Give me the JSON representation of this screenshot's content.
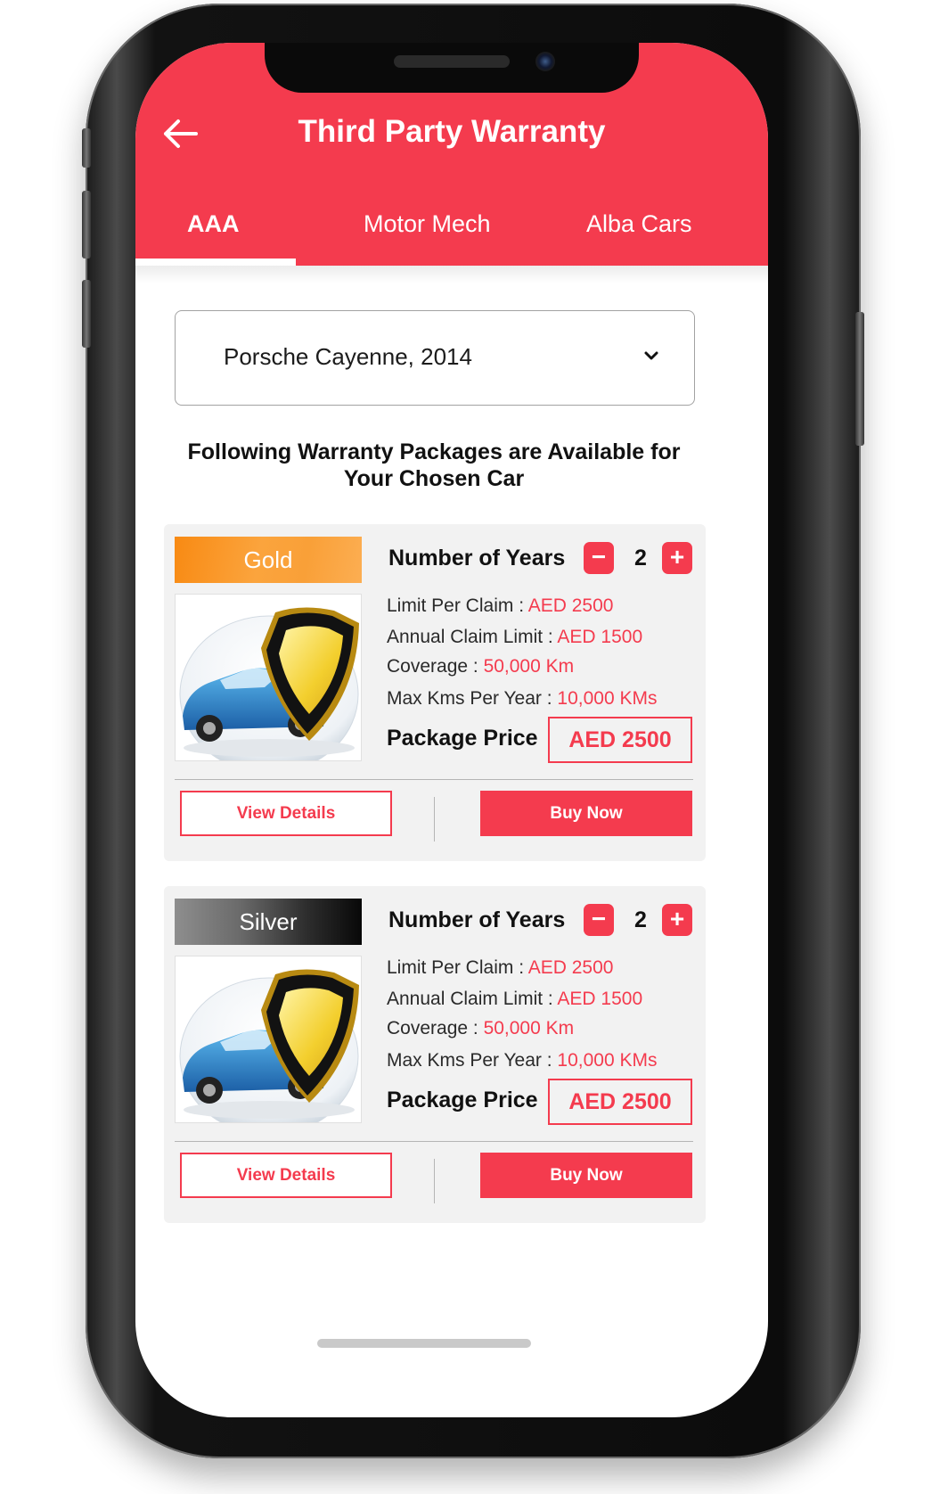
{
  "header": {
    "title": "Third Party Warranty",
    "back_icon": "arrow-left-icon",
    "background_color": "#f43b4e"
  },
  "tabs": [
    {
      "label": "AAA",
      "active": true
    },
    {
      "label": "Motor Mech",
      "active": false
    },
    {
      "label": "Alba Cars",
      "active": false
    }
  ],
  "car_select": {
    "value": "Porsche Cayenne, 2014",
    "icon": "chevron-down-icon"
  },
  "headline": {
    "line1": "Following Warranty Packages are Available for",
    "line2": "Your Chosen Car"
  },
  "packages": [
    {
      "tier": "Gold",
      "years_label": "Number of Years",
      "years": "2",
      "minus_label": "−",
      "plus_label": "+",
      "limit_per_claim_label": "Limit Per Claim : ",
      "limit_per_claim": "AED 2500",
      "annual_claim_limit_label": "Annual Claim Limit : ",
      "annual_claim_limit": "AED 1500",
      "coverage_label": "Coverage : ",
      "coverage": "50,000 Km",
      "max_kms_label": "Max Kms Per Year : ",
      "max_kms": "10,000 KMs",
      "price_label": "Package Price",
      "price": "AED 2500",
      "view_details": "View Details",
      "buy_now": "Buy Now"
    },
    {
      "tier": "Silver",
      "years_label": "Number of Years",
      "years": "2",
      "minus_label": "−",
      "plus_label": "+",
      "limit_per_claim_label": "Limit Per Claim : ",
      "limit_per_claim": "AED 2500",
      "annual_claim_limit_label": "Annual Claim Limit : ",
      "annual_claim_limit": "AED 1500",
      "coverage_label": "Coverage : ",
      "coverage": "50,000 Km",
      "max_kms_label": "Max Kms Per Year : ",
      "max_kms": "10,000 KMs",
      "price_label": "Package Price",
      "price": "AED 2500",
      "view_details": "View Details",
      "buy_now": "Buy Now"
    }
  ],
  "colors": {
    "accent": "#f43b4e",
    "gold_badge": "#f88a13",
    "silver_badge": "#3a3a3a",
    "card_background": "#f2f2f2"
  }
}
